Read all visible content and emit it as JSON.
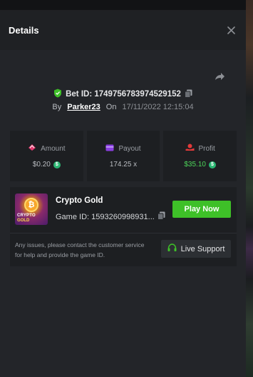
{
  "header": {
    "title": "Details"
  },
  "bet": {
    "id_text": "Bet ID: 1749756783974529152",
    "by_label": "By",
    "user": "Parker23",
    "on_label": "On",
    "datetime": "17/11/2022 12:15:04"
  },
  "stats": [
    {
      "label": "Amount",
      "value": "$0.20",
      "icon": "amount-icon",
      "has_coin": true
    },
    {
      "label": "Payout",
      "value": "174.25 x",
      "icon": "wallet-icon",
      "has_coin": false
    },
    {
      "label": "Profit",
      "value": "$35.10",
      "icon": "profit-icon",
      "has_coin": true
    }
  ],
  "game": {
    "name": "Crypto Gold",
    "id_text": "Game ID: 1593260998931...",
    "thumb_line1": "CRYPTO",
    "thumb_line2": "GOLD",
    "play_label": "Play Now",
    "notice": "Any issues, please contact the customer service for help and provide the game ID.",
    "support_label": "Live Support"
  },
  "colors": {
    "accent_green": "#3ec028",
    "profit_green": "#4dd65a",
    "amount_icon": "#e23a6f",
    "payout_icon": "#8a3fe0",
    "profit_icon": "#e23a3a"
  }
}
